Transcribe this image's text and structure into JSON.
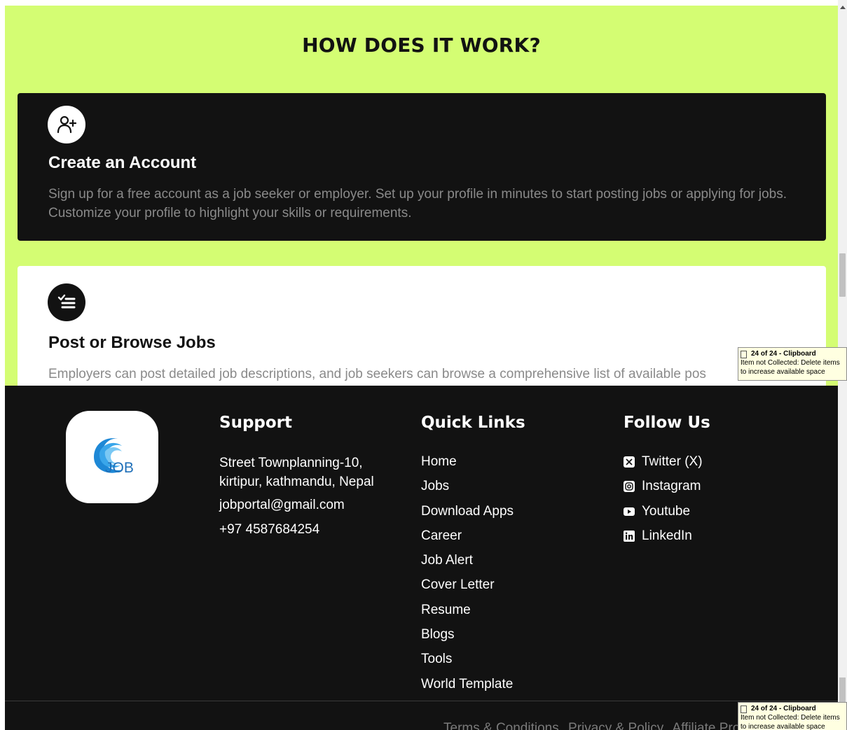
{
  "how_it_works": {
    "title": "HOW DOES IT WORK?",
    "steps": [
      {
        "icon": "user-plus-icon",
        "title": "Create an Account",
        "description": "Sign up for a free account as a job seeker or employer. Set up your profile in minutes to start posting jobs or applying for jobs. Customize your profile to highlight your skills or requirements."
      },
      {
        "icon": "checklist-icon",
        "title": "Post or Browse Jobs",
        "description": "Employers can post detailed job descriptions, and job seekers can browse a comprehensive list of available pos"
      }
    ]
  },
  "footer": {
    "logo_text": "JOB",
    "support": {
      "heading": "Support",
      "address": "Street Townplanning-10, kirtipur, kathmandu, Nepal",
      "email": "jobportal@gmail.com",
      "phone": "+97 4587684254"
    },
    "quick_links": {
      "heading": "Quick Links",
      "items": [
        "Home",
        "Jobs",
        "Download Apps",
        "Career",
        "Job Alert",
        "Cover Letter",
        "Resume",
        "Blogs",
        "Tools",
        "World Template"
      ]
    },
    "follow_us": {
      "heading": "Follow Us",
      "items": [
        {
          "label": "Twitter (X)",
          "icon": "x-twitter-icon"
        },
        {
          "label": "Instagram",
          "icon": "instagram-icon"
        },
        {
          "label": "Youtube",
          "icon": "youtube-icon"
        },
        {
          "label": "LinkedIn",
          "icon": "linkedin-icon"
        }
      ]
    },
    "bottom_links": [
      "Terms & Conditions",
      "Privacy & Policy",
      "Affiliate Pro"
    ]
  },
  "clipboard_notice": {
    "title": "24 of 24 - Clipboard",
    "message": "Item not Collected: Delete items to increase available space"
  },
  "colors": {
    "accent_green": "#d4fd73",
    "dark": "#121212"
  }
}
